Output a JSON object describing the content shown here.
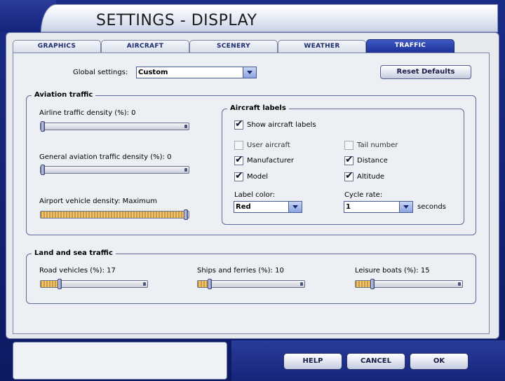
{
  "window": {
    "title": "SETTINGS - DISPLAY"
  },
  "tabs": [
    {
      "label": "GRAPHICS",
      "active": false
    },
    {
      "label": "AIRCRAFT",
      "active": false
    },
    {
      "label": "SCENERY",
      "active": false
    },
    {
      "label": "WEATHER",
      "active": false
    },
    {
      "label": "TRAFFIC",
      "active": true
    }
  ],
  "global_settings": {
    "label": "Global settings:",
    "value": "Custom"
  },
  "reset_button": {
    "label": "Reset Defaults"
  },
  "aviation_traffic": {
    "title": "Aviation traffic",
    "airline_density": {
      "label": "Airline traffic density (%): 0",
      "value": 0
    },
    "ga_density": {
      "label": "General aviation traffic density (%): 0",
      "value": 0
    },
    "airport_vehicle": {
      "label": "Airport vehicle density: Maximum",
      "value": 100
    }
  },
  "aircraft_labels": {
    "title": "Aircraft labels",
    "show_labels": {
      "label": "Show aircraft labels",
      "checked": true
    },
    "user_aircraft": {
      "label": "User aircraft",
      "checked": false
    },
    "tail_number": {
      "label": "Tail number",
      "checked": false
    },
    "manufacturer": {
      "label": "Manufacturer",
      "checked": true
    },
    "distance": {
      "label": "Distance",
      "checked": true
    },
    "model": {
      "label": "Model",
      "checked": true
    },
    "altitude": {
      "label": "Altitude",
      "checked": true
    },
    "label_color": {
      "label": "Label color:",
      "value": "Red"
    },
    "cycle_rate": {
      "label": "Cycle rate:",
      "value": "1",
      "unit": "seconds"
    }
  },
  "land_sea_traffic": {
    "title": "Land and sea traffic",
    "road_vehicles": {
      "label": "Road vehicles (%): 17",
      "value": 17
    },
    "ships_ferries": {
      "label": "Ships and ferries (%): 10",
      "value": 10
    },
    "leisure_boats": {
      "label": "Leisure boats (%): 15",
      "value": 15
    }
  },
  "footer": {
    "help": "HELP",
    "cancel": "CANCEL",
    "ok": "OK"
  },
  "colors": {
    "frame": "#0d1a63",
    "active_tab": "#2b43b0",
    "panel": "#eceff3"
  }
}
